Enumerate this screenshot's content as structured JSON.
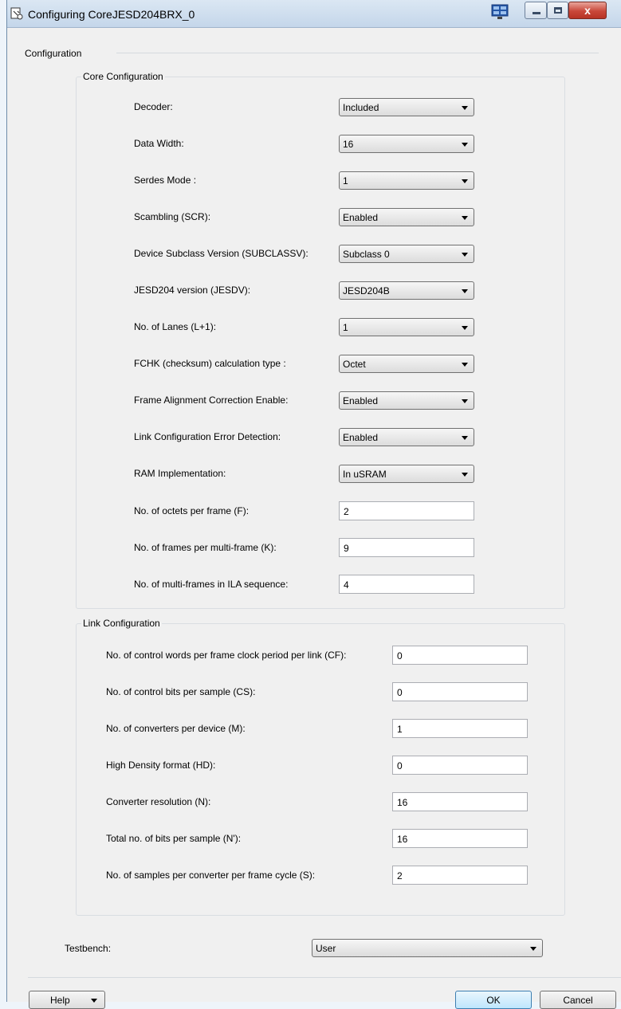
{
  "window": {
    "title": "Configuring CoreJESD204BRX_0",
    "icons": [
      "app-icon",
      "monitor-icon",
      "minimize-icon",
      "maximize-icon",
      "close-icon"
    ],
    "close_glyph": "x"
  },
  "configuration": {
    "label": "Configuration",
    "core": {
      "label": "Core Configuration",
      "rows": [
        {
          "label": "Decoder:",
          "value": "Included",
          "type": "select"
        },
        {
          "label": "Data Width:",
          "value": "16",
          "type": "select"
        },
        {
          "label": "Serdes Mode :",
          "value": "1",
          "type": "select"
        },
        {
          "label": "Scambling (SCR):",
          "value": "Enabled",
          "type": "select"
        },
        {
          "label": "Device Subclass Version (SUBCLASSV):",
          "value": "Subclass 0",
          "type": "select"
        },
        {
          "label": "JESD204 version (JESDV):",
          "value": "JESD204B",
          "type": "select"
        },
        {
          "label": "No. of Lanes (L+1):",
          "value": "1",
          "type": "select"
        },
        {
          "label": "FCHK (checksum) calculation type :",
          "value": "Octet",
          "type": "select"
        },
        {
          "label": "Frame Alignment Correction Enable:",
          "value": "Enabled",
          "type": "select"
        },
        {
          "label": "Link Configuration Error Detection:",
          "value": "Enabled",
          "type": "select"
        },
        {
          "label": "RAM Implementation:",
          "value": "In uSRAM",
          "type": "select"
        },
        {
          "label": "No. of octets per frame (F):",
          "value": "2",
          "type": "text"
        },
        {
          "label": "No. of frames per multi-frame (K):",
          "value": "9",
          "type": "text"
        },
        {
          "label": "No. of multi-frames in ILA sequence:",
          "value": "4",
          "type": "text"
        }
      ]
    },
    "link": {
      "label": "Link Configuration",
      "rows": [
        {
          "label": "No. of control words per frame clock period per link (CF):",
          "value": "0"
        },
        {
          "label": "No. of control bits per sample (CS):",
          "value": "0"
        },
        {
          "label": "No. of converters per device (M):",
          "value": "1"
        },
        {
          "label": "High Density format (HD):",
          "value": "0"
        },
        {
          "label": "Converter resolution (N):",
          "value": "16"
        },
        {
          "label": "Total no. of bits per sample (N'):",
          "value": "16"
        },
        {
          "label": "No. of samples per converter per frame cycle (S):",
          "value": "2"
        }
      ]
    },
    "testbench": {
      "label": "Testbench:",
      "value": "User"
    }
  },
  "footer": {
    "help_label": "Help",
    "ok_label": "OK",
    "cancel_label": "Cancel"
  }
}
